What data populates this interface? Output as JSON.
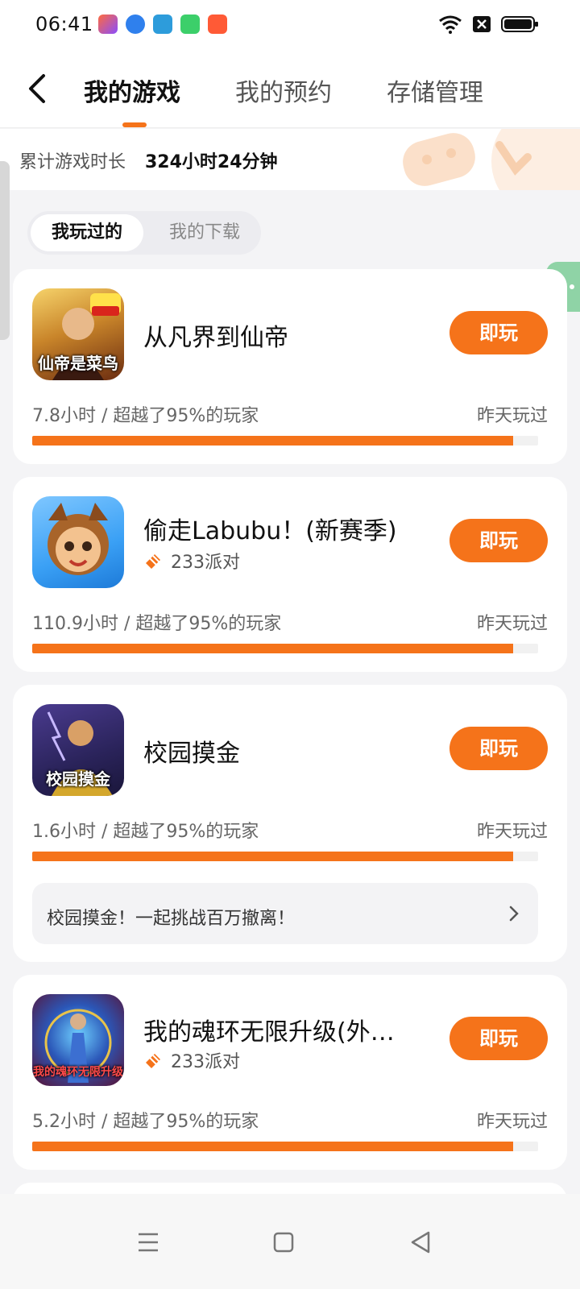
{
  "status_bar": {
    "time": "06:41",
    "battery_label": "battery"
  },
  "header": {
    "tabs": [
      {
        "label": "我的游戏",
        "active": true
      },
      {
        "label": "我的预约",
        "active": false
      },
      {
        "label": "存储管理",
        "active": false
      }
    ],
    "accent_color": "#f5731a"
  },
  "playtime": {
    "label": "累计游戏时长",
    "value": "324小时24分钟"
  },
  "segments": [
    {
      "label": "我玩过的",
      "active": true
    },
    {
      "label": "我的下载",
      "active": false
    }
  ],
  "games": [
    {
      "title": "从凡界到仙帝",
      "icon_text": "仙帝是菜鸟",
      "platform": null,
      "play_label": "即玩",
      "stats": "7.8小时 / 超越了95%的玩家",
      "last_played": "昨天玩过",
      "progress": 0.95
    },
    {
      "title": "偷走Labubu！(新赛季)",
      "icon_text": "",
      "platform": "233派对",
      "play_label": "即玩",
      "stats": "110.9小时 / 超越了95%的玩家",
      "last_played": "昨天玩过",
      "progress": 0.95
    },
    {
      "title": "校园摸金",
      "icon_text": "校园摸金",
      "platform": null,
      "play_label": "即玩",
      "stats": "1.6小时 / 超越了95%的玩家",
      "last_played": "昨天玩过",
      "progress": 0.95,
      "promo": "校园摸金！一起挑战百万撤离！"
    },
    {
      "title": "我的魂环无限升级(外国...",
      "icon_text": "我的魂环无限升级",
      "platform": "233派对",
      "play_label": "即玩",
      "stats": "5.2小时 / 超越了95%的玩家",
      "last_played": "昨天玩过",
      "progress": 0.95
    }
  ]
}
